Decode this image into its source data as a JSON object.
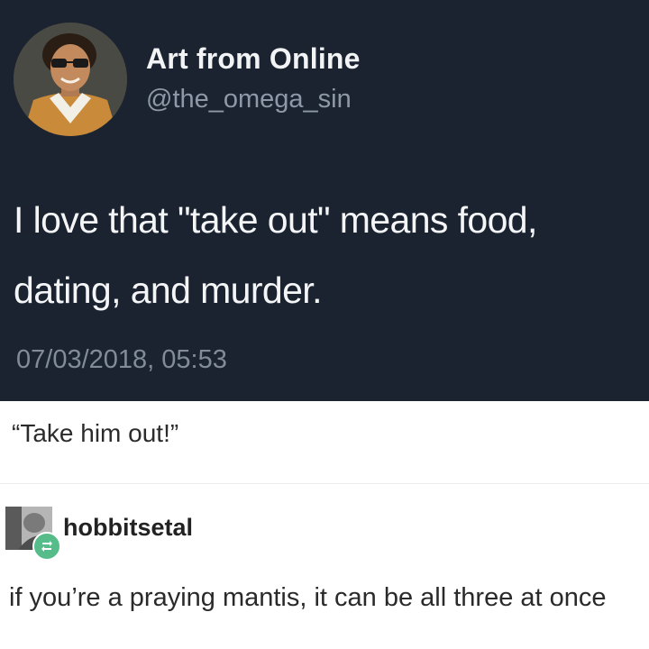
{
  "tweet": {
    "display_name": "Art from Online",
    "handle": "@the_omega_sin",
    "text": "I love that \"take out\" means food, dating, and murder.",
    "timestamp": "07/03/2018, 05:53"
  },
  "tumblr": {
    "quote": "“Take him out!”",
    "reply": {
      "blog_name": "hobbitsetal",
      "text": "if you’re a praying mantis, it can be all three at once"
    }
  },
  "icons": {
    "profile_avatar": "avatar-icon",
    "blog_avatar": "avatar-icon",
    "reblog_badge": "reblog-icon"
  },
  "colors": {
    "tweet_background": "#1b2331",
    "tweet_text": "#f4f5f7",
    "secondary_text": "#8e98a6",
    "reblog_green": "#56bc8a"
  }
}
